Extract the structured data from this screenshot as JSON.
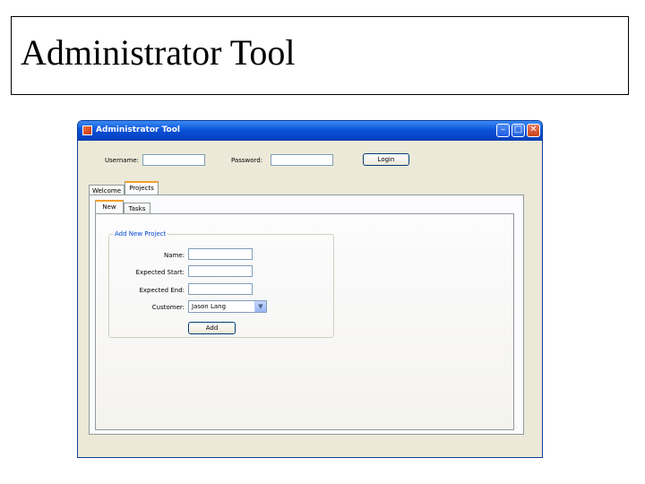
{
  "slide": {
    "title": "Administrator Tool"
  },
  "window": {
    "title": "Administrator Tool",
    "controls": {
      "minimize": "–",
      "maximize": "□",
      "close": "✕"
    }
  },
  "login": {
    "username_label": "Username:",
    "username_value": "",
    "password_label": "Password:",
    "password_value": "",
    "login_button": "Login"
  },
  "tabs": {
    "outer": [
      {
        "label": "Welcome",
        "active": false
      },
      {
        "label": "Projects",
        "active": true
      }
    ],
    "inner": [
      {
        "label": "New",
        "active": true
      },
      {
        "label": "Tasks",
        "active": false
      }
    ]
  },
  "add_project": {
    "group_title": "Add New Project",
    "name_label": "Name:",
    "name_value": "",
    "expected_start_label": "Expected Start:",
    "expected_start_value": "",
    "expected_end_label": "Expected End:",
    "expected_end_value": "",
    "customer_label": "Customer:",
    "customer_value": "Jason Lang",
    "add_button": "Add"
  },
  "colors": {
    "titlebar": "#0a52d8",
    "window_bg": "#ece9d8",
    "group_title": "#0046d5",
    "active_tab_accent": "#f0a030"
  }
}
